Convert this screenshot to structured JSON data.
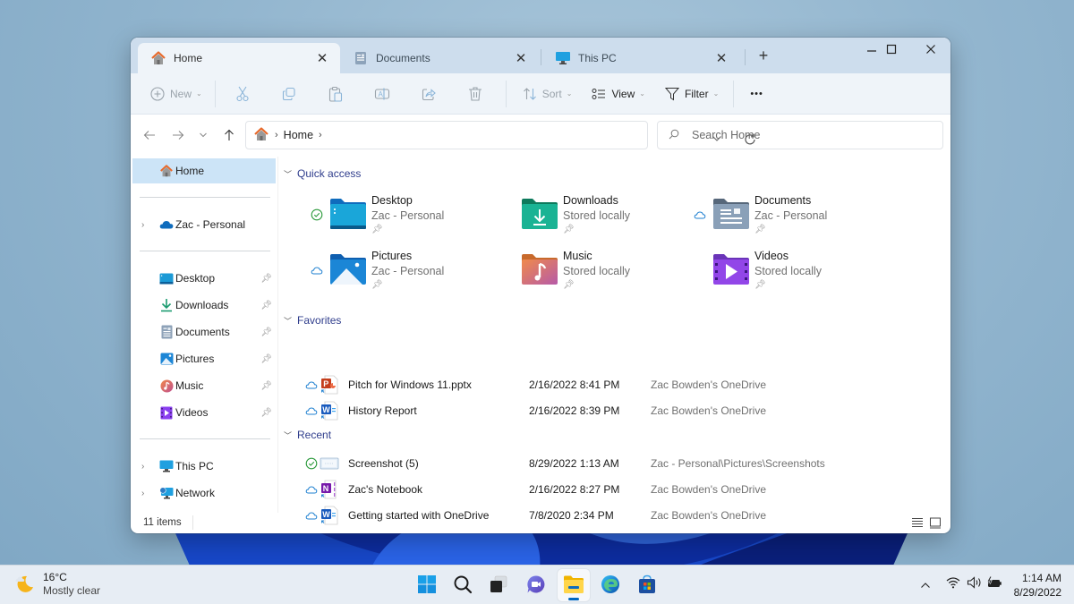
{
  "window": {
    "tabs": [
      {
        "label": "Home",
        "icon": "home-icon",
        "active": true
      },
      {
        "label": "Documents",
        "icon": "documents-icon",
        "active": false
      },
      {
        "label": "This PC",
        "icon": "this-pc-icon",
        "active": false
      }
    ],
    "new_tab_label": "+",
    "controls": {
      "minimize": "—",
      "maximize": "☐",
      "close": "✕"
    }
  },
  "toolbar": {
    "new_label": "New",
    "sort_label": "Sort",
    "view_label": "View",
    "filter_label": "Filter",
    "more_label": "•••",
    "icons": [
      "cut-icon",
      "copy-icon",
      "paste-icon",
      "rename-icon",
      "share-icon",
      "delete-icon"
    ]
  },
  "address": {
    "crumbs": [
      "Home"
    ],
    "search_placeholder": "Search Home"
  },
  "sidebar": {
    "home": "Home",
    "onedrive": "Zac - Personal",
    "pinned": [
      {
        "label": "Desktop",
        "icon": "desktop-folder-icon"
      },
      {
        "label": "Downloads",
        "icon": "downloads-icon"
      },
      {
        "label": "Documents",
        "icon": "documents-icon"
      },
      {
        "label": "Pictures",
        "icon": "pictures-icon"
      },
      {
        "label": "Music",
        "icon": "music-icon"
      },
      {
        "label": "Videos",
        "icon": "videos-icon"
      }
    ],
    "this_pc": "This PC",
    "network": "Network"
  },
  "content": {
    "quick_access_title": "Quick access",
    "quick_access": [
      {
        "name": "Desktop",
        "sub": "Zac - Personal",
        "status": "synced"
      },
      {
        "name": "Downloads",
        "sub": "Stored locally",
        "status": "none"
      },
      {
        "name": "Documents",
        "sub": "Zac - Personal",
        "status": "cloud"
      },
      {
        "name": "Pictures",
        "sub": "Zac - Personal",
        "status": "cloud"
      },
      {
        "name": "Music",
        "sub": "Stored locally",
        "status": "none"
      },
      {
        "name": "Videos",
        "sub": "Stored locally",
        "status": "none"
      }
    ],
    "favorites_title": "Favorites",
    "favorites": [
      {
        "name": "Pitch for Windows 11.pptx",
        "date": "2/16/2022 8:41 PM",
        "location": "Zac Bowden's OneDrive",
        "type": "powerpoint",
        "status": "cloud"
      },
      {
        "name": "History Report",
        "date": "2/16/2022 8:39 PM",
        "location": "Zac Bowden's OneDrive",
        "type": "word",
        "status": "cloud"
      }
    ],
    "recent_title": "Recent",
    "recent": [
      {
        "name": "Screenshot (5)",
        "date": "8/29/2022 1:13 AM",
        "location": "Zac - Personal\\Pictures\\Screenshots",
        "type": "image",
        "status": "synced"
      },
      {
        "name": "Zac's Notebook",
        "date": "2/16/2022 8:27 PM",
        "location": "Zac Bowden's OneDrive",
        "type": "onenote",
        "status": "cloud"
      },
      {
        "name": "Getting started with OneDrive",
        "date": "7/8/2020 2:34 PM",
        "location": "Zac Bowden's OneDrive",
        "type": "word",
        "status": "cloud"
      }
    ]
  },
  "status": {
    "item_count": "11 items"
  },
  "taskbar": {
    "weather_temp": "16°C",
    "weather_desc": "Mostly clear",
    "apps": [
      "start-icon",
      "search-icon",
      "task-view-icon",
      "teams-chat-icon",
      "file-explorer-icon",
      "edge-icon",
      "store-icon"
    ],
    "time": "1:14 AM",
    "date": "8/29/2022"
  },
  "colors": {
    "accent": "#0067c0",
    "section_header": "#2f3d8c",
    "selection": "#cce4f7"
  }
}
